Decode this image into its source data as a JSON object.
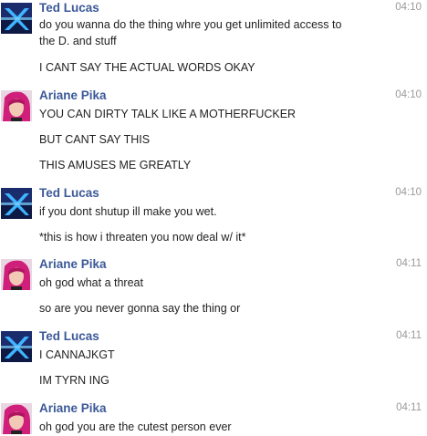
{
  "colors": {
    "sender_name": "#3b5998",
    "timestamp": "#9a9a9a",
    "text": "#222222"
  },
  "groups": [
    {
      "sender": "Ted Lucas",
      "avatar": "ted-avatar-icon",
      "time": "04:10",
      "messages": [
        "do you wanna do the thing whre you get unlimited access to",
        "the D. and stuff",
        "I CANT SAY THE ACTUAL WORDS OKAY"
      ]
    },
    {
      "sender": "Ariane Pika",
      "avatar": "ariane-avatar-icon",
      "time": "04:10",
      "messages": [
        "YOU CAN DIRTY TALK LIKE A MOTHERFUCKER",
        "BUT CANT SAY THIS",
        "THIS AMUSES ME GREATLY"
      ]
    },
    {
      "sender": "Ted Lucas",
      "avatar": "ted-avatar-icon",
      "time": "04:10",
      "messages": [
        "if you dont shutup ill make you wet.",
        "*this is how i threaten you now deal w/ it*"
      ]
    },
    {
      "sender": "Ariane Pika",
      "avatar": "ariane-avatar-icon",
      "time": "04:11",
      "messages": [
        "oh god what a threat",
        "so are you never gonna say the thing or"
      ]
    },
    {
      "sender": "Ted Lucas",
      "avatar": "ted-avatar-icon",
      "time": "04:11",
      "messages": [
        "I CANNAJKGT",
        "IM TYRN ING"
      ]
    },
    {
      "sender": "Ariane Pika",
      "avatar": "ariane-avatar-icon",
      "time": "04:11",
      "messages": [
        "oh god you are the cutest person ever"
      ]
    }
  ]
}
